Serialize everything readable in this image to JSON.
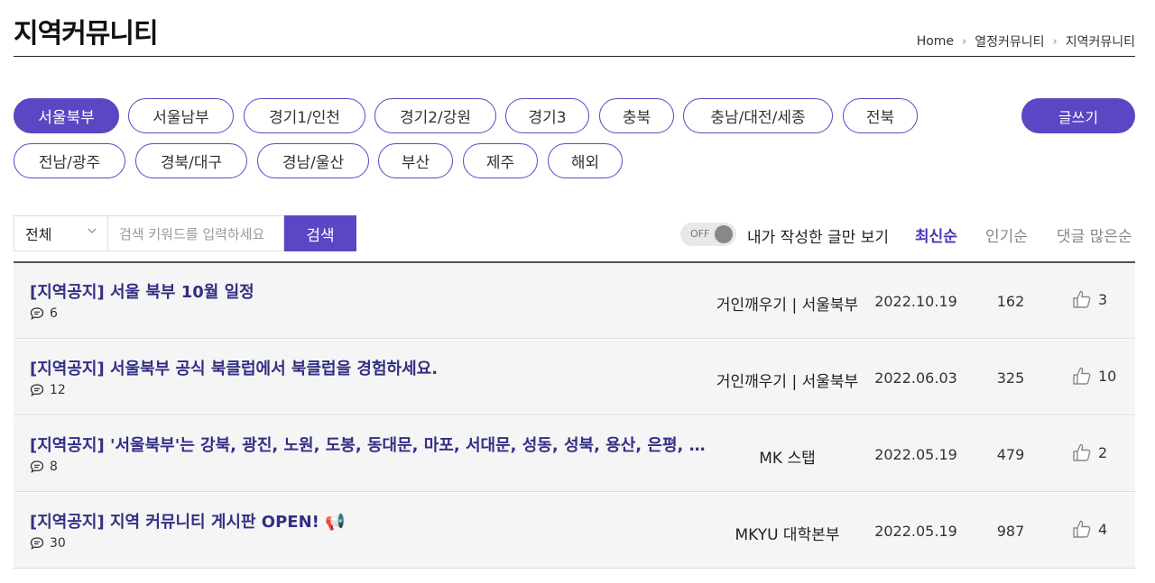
{
  "header": {
    "title": "지역커뮤니티",
    "breadcrumb": [
      "Home",
      "열정커뮤니티",
      "지역커뮤니티"
    ]
  },
  "regions": [
    {
      "label": "서울북부",
      "active": true
    },
    {
      "label": "서울남부",
      "active": false
    },
    {
      "label": "경기1/인천",
      "active": false
    },
    {
      "label": "경기2/강원",
      "active": false
    },
    {
      "label": "경기3",
      "active": false
    },
    {
      "label": "충북",
      "active": false
    },
    {
      "label": "충남/대전/세종",
      "active": false
    },
    {
      "label": "전북",
      "active": false
    },
    {
      "label": "전남/광주",
      "active": false
    },
    {
      "label": "경북/대구",
      "active": false
    },
    {
      "label": "경남/울산",
      "active": false
    },
    {
      "label": "부산",
      "active": false
    },
    {
      "label": "제주",
      "active": false
    },
    {
      "label": "해외",
      "active": false
    }
  ],
  "write_label": "글쓰기",
  "search": {
    "scope": "전체",
    "placeholder": "검색 키워드를 입력하세요",
    "button": "검색"
  },
  "filter": {
    "toggle_state": "OFF",
    "mine_label": "내가 작성한 글만 보기"
  },
  "sort": [
    {
      "label": "최신순",
      "active": true
    },
    {
      "label": "인기순",
      "active": false
    },
    {
      "label": "댓글 많은순",
      "active": false
    }
  ],
  "accent_color": "#5b46c4",
  "posts": [
    {
      "title": "[지역공지] 서울 북부 10월 일정",
      "comments": "6",
      "author": "거인깨우기 | 서울북부",
      "date": "2022.10.19",
      "views": "162",
      "likes": "3"
    },
    {
      "title": "[지역공지] 서울북부 공식 북클럽에서 북클럽을 경험하세요.",
      "comments": "12",
      "author": "거인깨우기 | 서울북부",
      "date": "2022.06.03",
      "views": "325",
      "likes": "10"
    },
    {
      "title": "[지역공지] '서울북부'는 강북, 광진, 노원, 도봉, 동대문, 마포, 서대문, 성동, 성북, 용산, 은평, 종로, 중구, 중랑",
      "comments": "8",
      "author": "MK 스탭",
      "date": "2022.05.19",
      "views": "479",
      "likes": "2"
    },
    {
      "title": "[지역공지] 지역 커뮤니티 게시판 OPEN! 📢",
      "comments": "30",
      "author": "MKYU 대학본부",
      "date": "2022.05.19",
      "views": "987",
      "likes": "4"
    }
  ]
}
